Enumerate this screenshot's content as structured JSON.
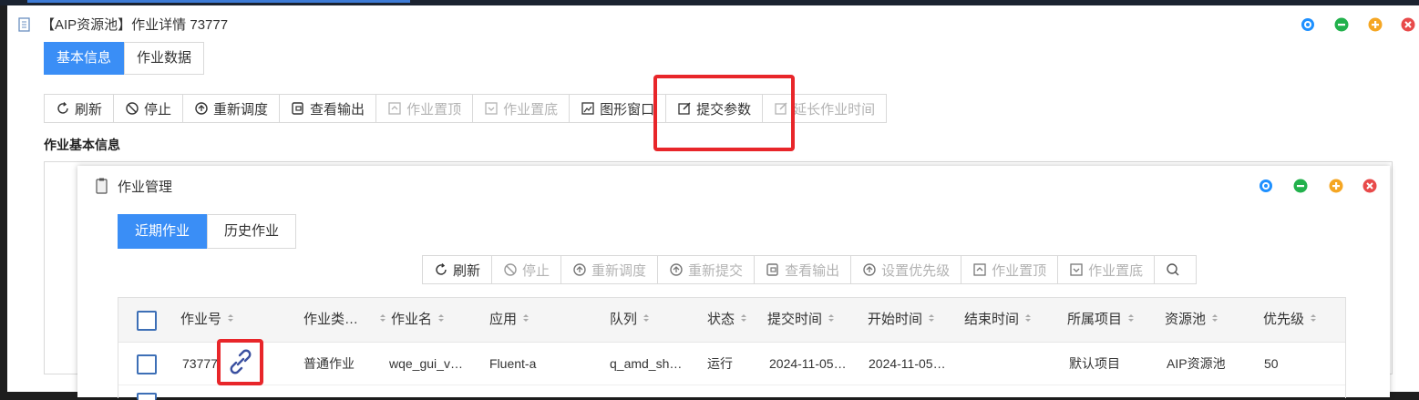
{
  "window": {
    "title": "【AIP资源池】作业详情 73777",
    "tabs": [
      {
        "label": "基本信息",
        "active": true
      },
      {
        "label": "作业数据",
        "active": false
      }
    ]
  },
  "toolbar": {
    "buttons": [
      {
        "label": "刷新",
        "icon": "refresh-icon",
        "enabled": true
      },
      {
        "label": "停止",
        "icon": "stop-icon",
        "enabled": true
      },
      {
        "label": "重新调度",
        "icon": "reschedule-icon",
        "enabled": true
      },
      {
        "label": "查看输出",
        "icon": "output-icon",
        "enabled": true
      },
      {
        "label": "作业置顶",
        "icon": "top-icon",
        "enabled": false
      },
      {
        "label": "作业置底",
        "icon": "bottom-icon",
        "enabled": false
      },
      {
        "label": "图形窗口",
        "icon": "graphic-window-icon",
        "enabled": true
      },
      {
        "label": "提交参数",
        "icon": "edit-icon",
        "enabled": true
      },
      {
        "label": "延长作业时间",
        "icon": "edit-icon",
        "enabled": false
      }
    ]
  },
  "section": {
    "title": "作业基本信息"
  },
  "dialog": {
    "title": "作业管理",
    "tabs": [
      {
        "label": "近期作业",
        "active": true
      },
      {
        "label": "历史作业",
        "active": false
      }
    ],
    "toolbar": [
      {
        "label": "刷新",
        "icon": "refresh-icon",
        "enabled": true
      },
      {
        "label": "停止",
        "icon": "stop-icon",
        "enabled": false
      },
      {
        "label": "重新调度",
        "icon": "reschedule-icon",
        "enabled": false
      },
      {
        "label": "重新提交",
        "icon": "resubmit-icon",
        "enabled": false
      },
      {
        "label": "查看输出",
        "icon": "output-icon",
        "enabled": false
      },
      {
        "label": "设置优先级",
        "icon": "priority-icon",
        "enabled": false
      },
      {
        "label": "作业置顶",
        "icon": "top-icon",
        "enabled": false
      },
      {
        "label": "作业置底",
        "icon": "bottom-icon",
        "enabled": false
      }
    ],
    "table": {
      "columns": [
        "作业号",
        "作业类…",
        "作业名",
        "应用",
        "队列",
        "状态",
        "提交时间",
        "开始时间",
        "结束时间",
        "所属项目",
        "资源池",
        "优先级"
      ],
      "rows": [
        {
          "job_id": "73777",
          "type": "普通作业",
          "name": "wqe_gui_v…",
          "app": "Fluent-a",
          "queue": "q_amd_sh…",
          "status": "运行",
          "submit_time": "2024-11-05…",
          "start_time": "2024-11-05…",
          "end_time": "",
          "project": "默认项目",
          "pool": "AIP资源池",
          "priority": "50"
        }
      ]
    }
  },
  "colors": {
    "accent": "#3a8ef6",
    "highlight": "#e8262a",
    "running": "#2eb34a",
    "link": "#3a7bd5"
  }
}
